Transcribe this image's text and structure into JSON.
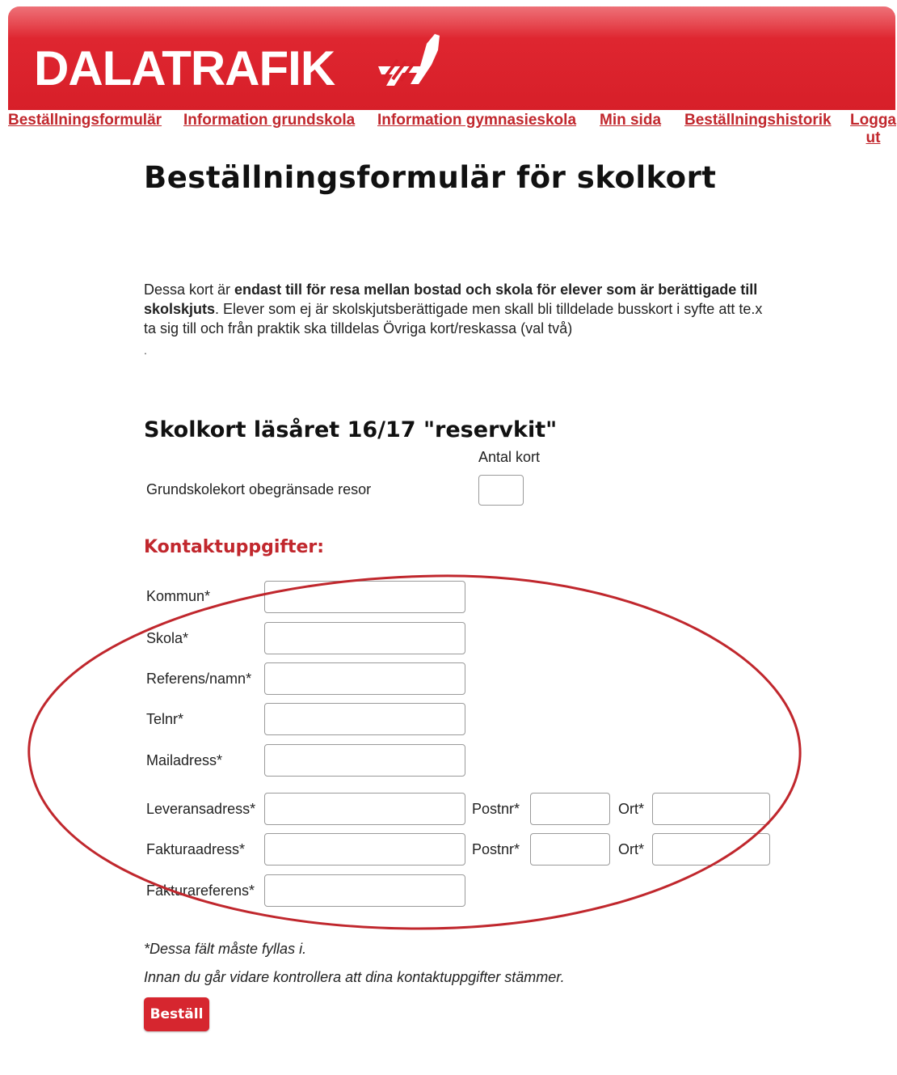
{
  "brand": {
    "logo_text": "DALATRAFIK",
    "accent_color": "#d71f29",
    "link_color": "#c1272d"
  },
  "nav": {
    "items": [
      {
        "label": "Beställningsformulär"
      },
      {
        "label": "Information grundskola"
      },
      {
        "label": "Information gymnasieskola"
      },
      {
        "label": "Min sida"
      },
      {
        "label": "Beställningshistorik"
      }
    ],
    "logout_line1": "Logga",
    "logout_line2": "ut"
  },
  "page": {
    "title": "Beställningsformulär för skolkort",
    "intro_prefix": "Dessa kort är ",
    "intro_bold": "endast till för resa mellan bostad och skola för elever som är berättigade till skolskjuts",
    "intro_suffix": ". Elever som ej är skolskjutsberättigade men skall bli tilldelade busskort i syfte att te.x ta sig till och från praktik ska tilldelas Övriga kort/reskassa (val två)",
    "dot": "."
  },
  "cards": {
    "section_title": "Skolkort läsåret 16/17 \"reservkit\"",
    "quantity_header": "Antal kort",
    "rows": [
      {
        "label": "Grundskolekort obegränsade resor",
        "value": ""
      }
    ]
  },
  "contact": {
    "title": "Kontaktuppgifter:",
    "fields": [
      {
        "label": "Kommun*",
        "value": ""
      },
      {
        "label": "Skola*",
        "value": ""
      },
      {
        "label": "Referens/namn*",
        "value": ""
      },
      {
        "label": "Telnr*",
        "value": ""
      },
      {
        "label": "Mailadress*",
        "value": ""
      },
      {
        "label": "Leveransadress*",
        "value": ""
      },
      {
        "label": "Fakturaadress*",
        "value": ""
      },
      {
        "label": "Fakturareferens*",
        "value": ""
      }
    ],
    "postnr_label": "Postnr*",
    "ort_label": "Ort*"
  },
  "footer": {
    "required_note": "*Dessa fält måste fyllas i.",
    "check_note": "Innan du går vidare kontrollera att dina kontaktuppgifter stämmer.",
    "order_button": "Beställ"
  },
  "annotation": {
    "shape": "ellipse",
    "color": "#c0272d"
  }
}
